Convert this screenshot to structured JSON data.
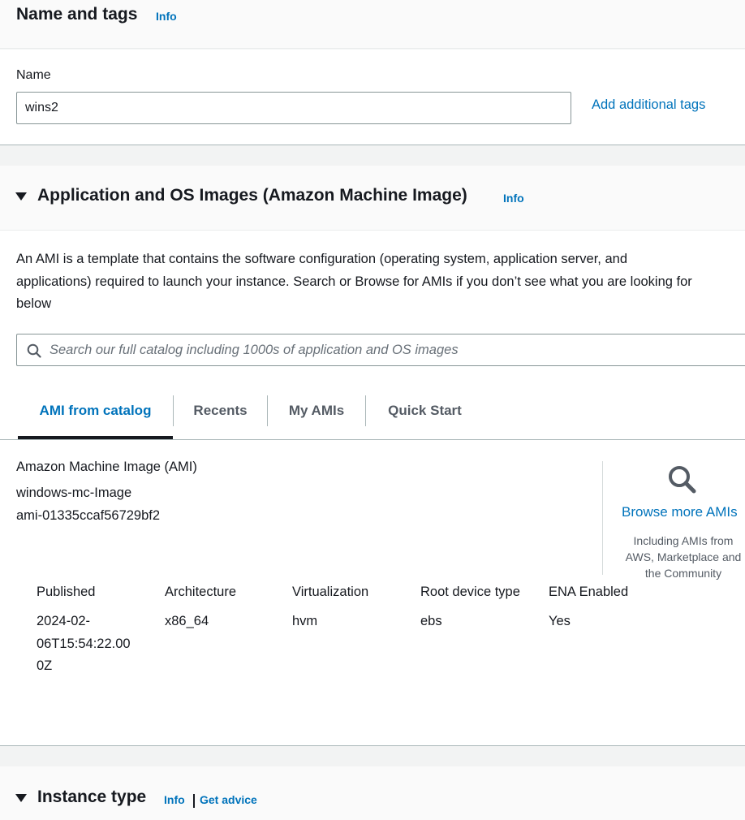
{
  "name_tags": {
    "title": "Name and tags",
    "info": "Info",
    "name_label": "Name",
    "name_value": "wins2",
    "add_tags": "Add additional tags"
  },
  "ami_section": {
    "title": "Application and OS Images (Amazon Machine Image)",
    "info": "Info",
    "description_lines": [
      "An AMI is a template that contains the software configuration (operating system, application server, and",
      "applications) required to launch your instance. Search or Browse for AMIs if you don’t see what you are looking for",
      "below"
    ],
    "search_placeholder": "Search our full catalog including 1000s of application and OS images",
    "tabs": [
      {
        "label": "AMI from catalog",
        "active": true
      },
      {
        "label": "Recents",
        "active": false
      },
      {
        "label": "My AMIs",
        "active": false
      },
      {
        "label": "Quick Start",
        "active": false
      }
    ],
    "ami_heading": "Amazon Machine Image (AMI)",
    "ami_name": "windows-mc-Image",
    "ami_id": "ami-01335ccaf56729bf2",
    "browse_link": "Browse more AMIs",
    "browse_note_lines": [
      "Including AMIs from",
      "AWS, Marketplace and",
      "the Community"
    ],
    "details": [
      {
        "label": "Published",
        "value_lines": [
          "2024-02-",
          "06T15:54:22.00",
          "0Z"
        ]
      },
      {
        "label": "Architecture",
        "value_lines": [
          "x86_64"
        ]
      },
      {
        "label": "Virtualization",
        "value_lines": [
          "hvm"
        ]
      },
      {
        "label": "Root device type",
        "value_lines": [
          "ebs"
        ]
      },
      {
        "label": "ENA Enabled",
        "value_lines": [
          "Yes"
        ]
      }
    ]
  },
  "instance_type": {
    "title": "Instance type",
    "info": "Info",
    "advice": "Get advice"
  },
  "icons": {
    "caret": "caret-down-icon",
    "search": "search-icon"
  },
  "colors": {
    "link": "#0073bb",
    "text": "#16191f",
    "muted": "#545b64",
    "border": "#879596"
  }
}
